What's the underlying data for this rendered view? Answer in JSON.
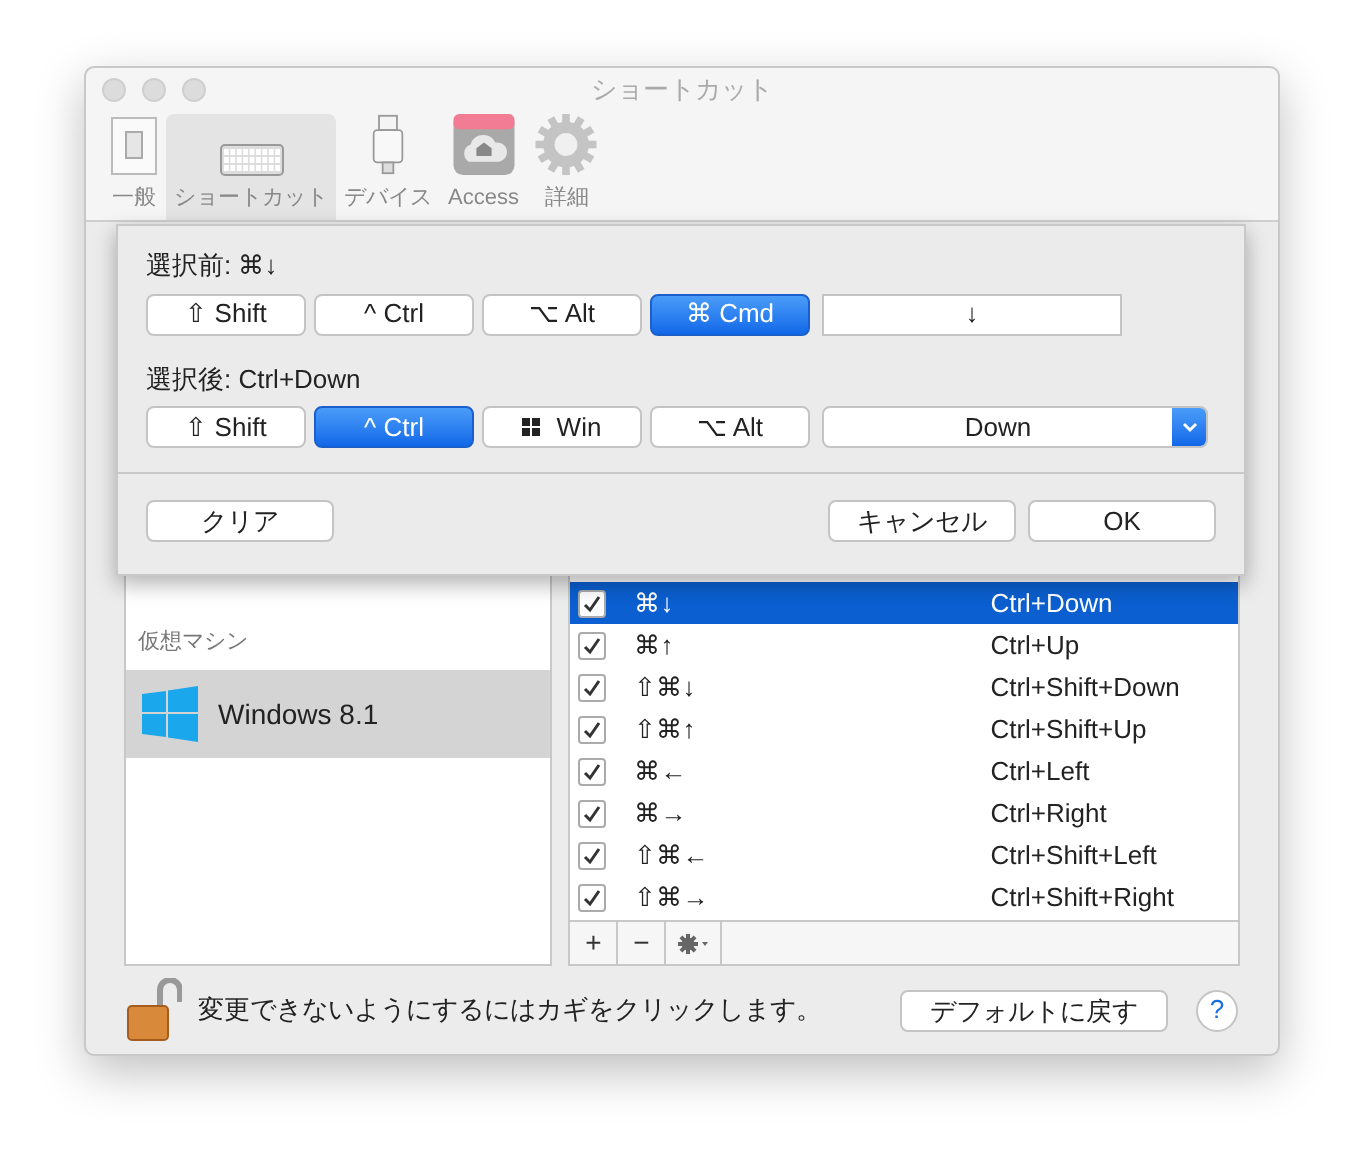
{
  "window": {
    "title": "ショートカット"
  },
  "toolbar": [
    {
      "label": "一般",
      "kind": "switch",
      "selected": false
    },
    {
      "label": "ショートカット",
      "kind": "keyboard",
      "selected": true
    },
    {
      "label": "デバイス",
      "kind": "usb",
      "selected": false
    },
    {
      "label": "Access",
      "kind": "cloud",
      "selected": false
    },
    {
      "label": "詳細",
      "kind": "gear",
      "selected": false
    }
  ],
  "sheet": {
    "before_label": "選択前: ⌘↓",
    "before_modifiers": [
      {
        "label": "⇧ Shift",
        "kind": "text",
        "selected": false
      },
      {
        "label": "^ Ctrl",
        "kind": "text",
        "selected": false
      },
      {
        "label": "⌥ Alt",
        "kind": "text",
        "selected": false
      },
      {
        "label": "⌘ Cmd",
        "kind": "text",
        "selected": true
      }
    ],
    "before_key": "↓",
    "after_label": "選択後: Ctrl+Down",
    "after_modifiers": [
      {
        "label": "⇧ Shift",
        "kind": "text",
        "selected": false
      },
      {
        "label": "^ Ctrl",
        "kind": "text",
        "selected": true
      },
      {
        "label": "Win",
        "kind": "windows",
        "selected": false
      },
      {
        "label": "⌥ Alt",
        "kind": "text",
        "selected": false
      }
    ],
    "after_key": "Down",
    "buttons": [
      {
        "label": "クリア",
        "kind": "left"
      },
      {
        "label": "キャンセル",
        "kind": "right"
      },
      {
        "label": "OK",
        "kind": "right"
      }
    ]
  },
  "sidebar": {
    "heading": "仮想マシン",
    "items": [
      {
        "label": "Windows 8.1",
        "selected": true
      }
    ]
  },
  "shortcuts": [
    {
      "osx": "⌘↓",
      "windows": "Ctrl+Down",
      "checked": true,
      "selected": true
    },
    {
      "osx": "⌘↑",
      "windows": "Ctrl+Up",
      "checked": true,
      "selected": false
    },
    {
      "osx": "⇧⌘↓",
      "windows": "Ctrl+Shift+Down",
      "checked": true,
      "selected": false
    },
    {
      "osx": "⇧⌘↑",
      "windows": "Ctrl+Shift+Up",
      "checked": true,
      "selected": false
    },
    {
      "osx": "⌘←",
      "windows": "Ctrl+Left",
      "checked": true,
      "selected": false
    },
    {
      "osx": "⌘→",
      "windows": "Ctrl+Right",
      "checked": true,
      "selected": false
    },
    {
      "osx": "⇧⌘←",
      "windows": "Ctrl+Shift+Left",
      "checked": true,
      "selected": false
    },
    {
      "osx": "⇧⌘→",
      "windows": "Ctrl+Shift+Right",
      "checked": true,
      "selected": false
    }
  ],
  "list_footer": [
    "+",
    "−"
  ],
  "footer": {
    "lock_text": "変更できないようにするにはカギをクリックします。",
    "default_button": "デフォルトに戻す",
    "help": "?"
  }
}
